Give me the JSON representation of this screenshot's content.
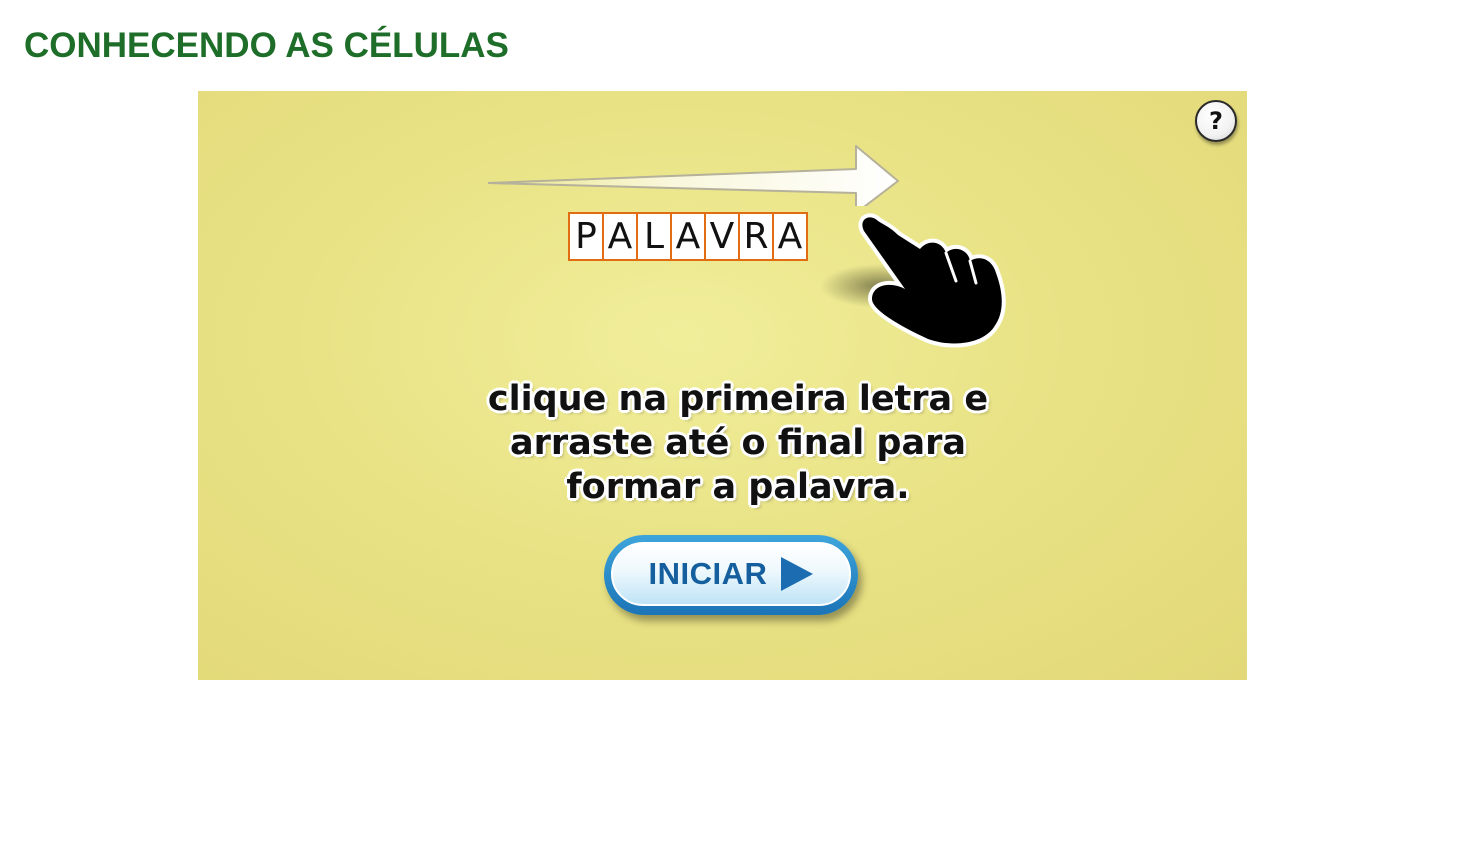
{
  "page": {
    "title": "CONHECENDO AS CÉLULAS"
  },
  "game": {
    "help_label": "?",
    "demo_word_letters": [
      "P",
      "A",
      "L",
      "A",
      "V",
      "R",
      "A"
    ],
    "instructions": [
      "clique na primeira letra e",
      "arraste até o final para",
      "formar a palavra."
    ],
    "start_label": "INICIAR"
  },
  "icons": {
    "help": "question-mark-icon",
    "arrow": "right-arrow-icon",
    "hand": "pointing-hand-icon",
    "play": "play-triangle-icon"
  },
  "colors": {
    "title": "#1e6e2a",
    "stage_background": "#e9e386",
    "letter_border": "#e26c12",
    "start_button": "#1b74b6",
    "start_text": "#155f9e"
  }
}
